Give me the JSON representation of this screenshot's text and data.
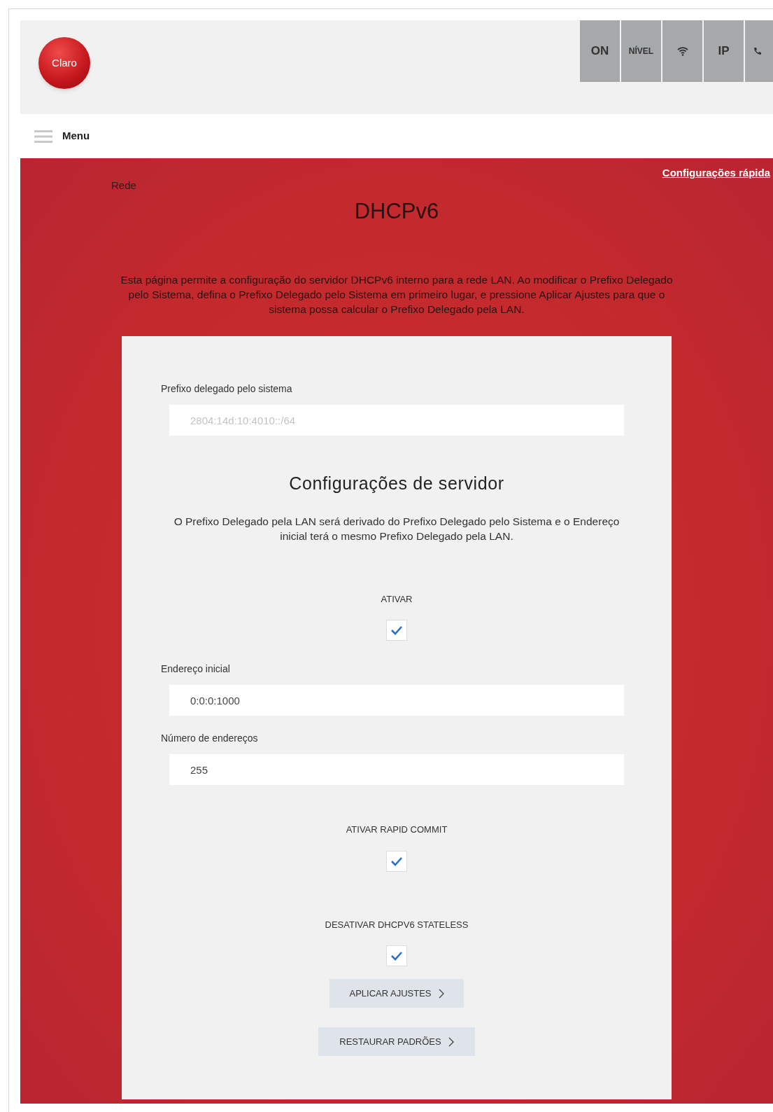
{
  "header": {
    "logo": "Claro",
    "status_tiles": [
      {
        "kind": "text",
        "label": "ON"
      },
      {
        "kind": "text",
        "label": "NÍVEL"
      },
      {
        "kind": "wifi"
      },
      {
        "kind": "text",
        "label": "IP"
      },
      {
        "kind": "phone"
      }
    ]
  },
  "menu": {
    "label": "Menu"
  },
  "breadcrumb": "Rede",
  "quick_link": "Configurações rápida",
  "title": "DHCPv6",
  "description": "Esta página permite a configuração do servidor DHCPv6 interno para a rede LAN. Ao modificar o Prefixo Delegado pelo Sistema, defina o Prefixo Delegado pelo Sistema em primeiro lugar, e pressione Aplicar Ajustes para que o sistema possa calcular o Prefixo Delegado pela LAN.",
  "form": [
    {
      "kind": "field",
      "label": "Prefixo delegado pelo sistema",
      "value": "2804:14d:10:4010::/64",
      "disabled": true
    },
    {
      "kind": "heading",
      "text": "Configurações de servidor"
    },
    {
      "kind": "note",
      "text": "O Prefixo Delegado pela LAN será derivado do Prefixo Delegado pelo Sistema e o Endereço inicial terá o mesmo Prefixo Delegado pela LAN."
    },
    {
      "kind": "checkbox",
      "label": "ATIVAR",
      "checked": true
    },
    {
      "kind": "field",
      "label": "Endereço inicial",
      "value": "0:0:0:1000",
      "disabled": false
    },
    {
      "kind": "field",
      "label": "Número de endereços",
      "value": "255",
      "disabled": false
    },
    {
      "kind": "checkbox",
      "label": "ATIVAR RAPID COMMIT",
      "checked": true
    },
    {
      "kind": "checkbox",
      "label": "DESATIVAR DHCPV6 STATELESS",
      "checked": true
    }
  ],
  "buttons": [
    {
      "label": "APLICAR AJUSTES"
    },
    {
      "label": "RESTAURAR PADRÕES"
    }
  ]
}
